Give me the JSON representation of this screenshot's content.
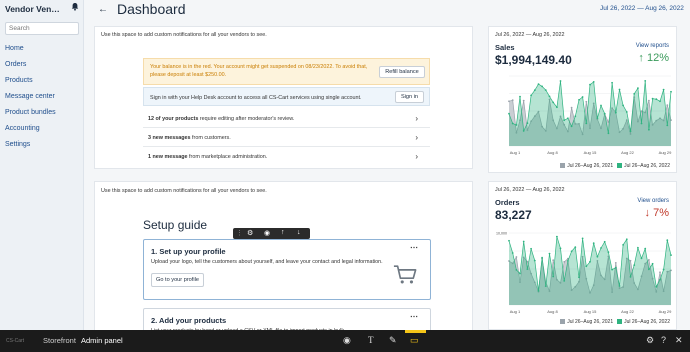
{
  "sidebar": {
    "vendor_name": "Vendor Ven…",
    "search_placeholder": "Search",
    "items": [
      "Home",
      "Orders",
      "Products",
      "Message center",
      "Product bundles",
      "Accounting",
      "Settings"
    ]
  },
  "header": {
    "title": "Dashboard",
    "date_range": "Jul 26, 2022 — Aug 26, 2022"
  },
  "notifications": {
    "hint_top": "Use this space to add custom notifications for all your vendors to see.",
    "warning": "Your balance is in the red. Your account might get suspended on 08/23/2022. To avoid that, please deposit at least $250.00.",
    "refill_label": "Refill balance",
    "signin_text": "Sign in with your Help Desk account to access all CS-Cart services using single account.",
    "signin_label": "Sign in",
    "messages": [
      {
        "bold": "12 of your products",
        "rest": " require editing after moderator's review."
      },
      {
        "bold": "3 new messages",
        "rest": " from customers."
      },
      {
        "bold": "1 new message",
        "rest": " from marketplace administration."
      }
    ],
    "hint_bottom": "Use this space to add custom notifications for all your vendors to see."
  },
  "setup": {
    "title": "Setup guide",
    "step1_title": "1. Set up your profile",
    "step1_text": "Upload your logo, tell the customers about yourself, and leave your contact and legal information.",
    "step1_button": "Go to your profile",
    "step2_title": "2. Add your products",
    "step2_text": "List your products by hand or upload a CSV or XML file to import products in bulk."
  },
  "sales": {
    "date": "Jul 26, 2022 — Aug 26, 2022",
    "name": "Sales",
    "link": "View reports",
    "value": "$1,994,149.40",
    "change": "↑ 12%",
    "change_color": "#3a9a5b",
    "x_ticks": [
      "Aug 1",
      "Aug 8",
      "Aug 15",
      "Aug 22",
      "Aug 29"
    ],
    "legend": [
      "Jul 26–Aug 26, 2021",
      "Jul 26–Aug 26, 2022"
    ]
  },
  "orders": {
    "date": "Jul 26, 2022 — Aug 26, 2022",
    "name": "Orders",
    "link": "View orders",
    "value": "83,227",
    "change": "↓ 7%",
    "change_color": "#c0392b",
    "y_top": "10,000",
    "x_ticks": [
      "Aug 1",
      "Aug 8",
      "Aug 15",
      "Aug 22",
      "Aug 29"
    ],
    "legend": [
      "Jul 26–Aug 26, 2021",
      "Jul 26–Aug 26, 2022"
    ]
  },
  "bottom_bar": {
    "logo": "CS-Cart",
    "tabs": [
      "Storefront",
      "Admin panel"
    ]
  },
  "colors": {
    "series_2021": "#9aa3ab",
    "series_2022": "#2fb380"
  }
}
